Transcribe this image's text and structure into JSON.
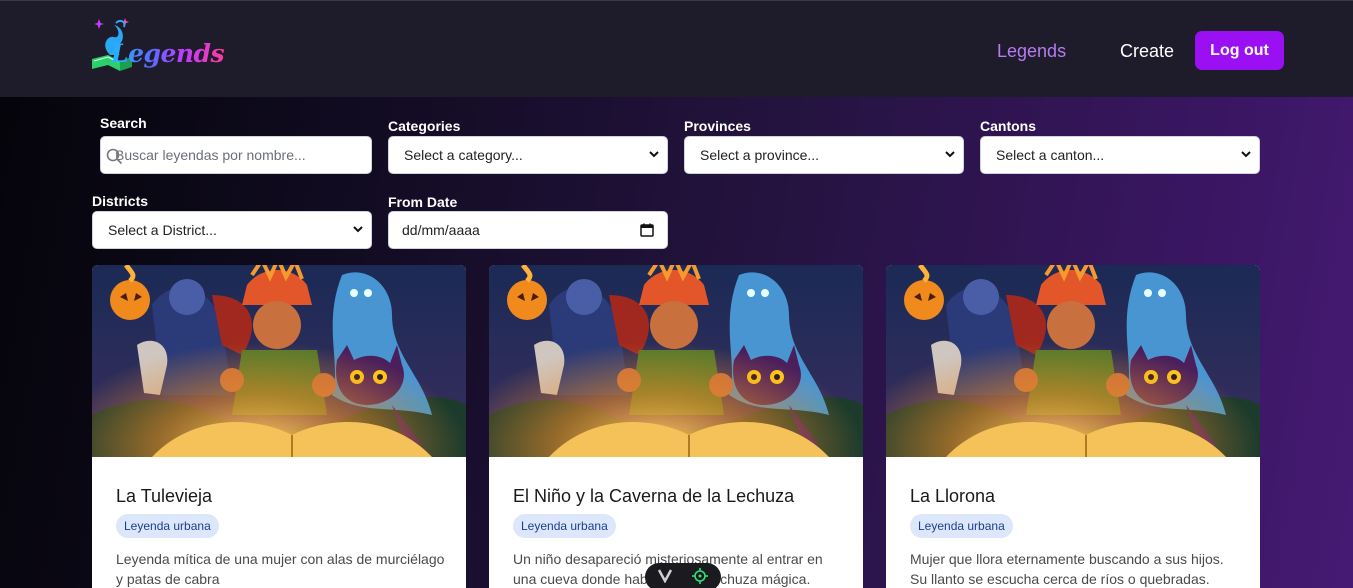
{
  "header": {
    "logo_text": "Legends",
    "nav": [
      {
        "label": "Legends"
      },
      {
        "label": "Create"
      }
    ],
    "logout_label": "Log out"
  },
  "filters": {
    "search": {
      "label": "Search",
      "placeholder": "Buscar leyendas por nombre..."
    },
    "categories": {
      "label": "Categories",
      "selected": "Select a category..."
    },
    "provinces": {
      "label": "Provinces",
      "selected": "Select a province..."
    },
    "cantons": {
      "label": "Cantons",
      "selected": "Select a canton..."
    },
    "districts": {
      "label": "Districts",
      "selected": "Select a District..."
    },
    "from_date": {
      "label": "From Date",
      "placeholder": "dd/mm/aaaa"
    }
  },
  "cards": [
    {
      "title": "La Tulevieja",
      "badge": "Leyenda urbana",
      "description": "Leyenda mítica de una mujer con alas de murciélago y patas de cabra"
    },
    {
      "title": "El Niño y la Caverna de la Lechuza",
      "badge": "Leyenda urbana",
      "description": "Un niño desapareció misteriosamente al entrar en una cueva donde habitaba una lechuza mágica."
    },
    {
      "title": "La Llorona",
      "badge": "Leyenda urbana",
      "description": "Mujer que llora eternamente buscando a sus hijos. Su llanto se escucha cerca de ríos o quebradas."
    }
  ],
  "colors": {
    "accent": "#9b10f2",
    "nav_active": "#b57bf2",
    "badge_bg": "#dde7fb",
    "badge_text": "#1b3f8f"
  },
  "icons": [
    "logo-icon",
    "search-icon",
    "chevron-down-icon",
    "calendar-icon",
    "toolbar-v-icon",
    "target-icon"
  ]
}
